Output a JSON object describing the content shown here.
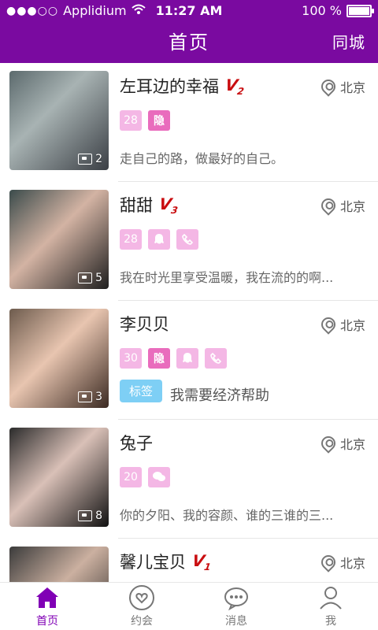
{
  "statusbar": {
    "carrier": "Applidium",
    "time": "11:27 AM",
    "battery": "100 %"
  },
  "header": {
    "title": "首页",
    "right_link": "同城"
  },
  "list": [
    {
      "name": "左耳边的幸福",
      "vip_level": "2",
      "location": "北京",
      "age": "28",
      "badges": [
        "隐"
      ],
      "desc": "走自己的路，做最好的自己。",
      "photo_count": "2"
    },
    {
      "name": "甜甜",
      "vip_level": "3",
      "location": "北京",
      "age": "28",
      "badges": [
        "qq-icon",
        "phone-icon"
      ],
      "desc": "我在时光里享受温暖，我在流的的啊...",
      "photo_count": "5"
    },
    {
      "name": "李贝贝",
      "vip_level": "",
      "location": "北京",
      "age": "30",
      "badges": [
        "隐",
        "qq-icon",
        "phone-icon"
      ],
      "tag": "标签",
      "desc": "我需要经济帮助",
      "photo_count": "3"
    },
    {
      "name": "兔子",
      "vip_level": "",
      "location": "北京",
      "age": "20",
      "badges": [
        "wechat-icon"
      ],
      "desc": "你的夕阳、我的容颜、谁的三谁的三...",
      "photo_count": "8"
    },
    {
      "name": "馨儿宝贝",
      "vip_level": "1",
      "location": "北京",
      "age": "",
      "badges": [],
      "desc": "",
      "photo_count": ""
    }
  ],
  "tabs": [
    {
      "label": "首页",
      "active": true
    },
    {
      "label": "约会",
      "active": false
    },
    {
      "label": "消息",
      "active": false
    },
    {
      "label": "我",
      "active": false
    }
  ],
  "colors": {
    "header_bg": "#7a0aa0",
    "tab_active": "#8000b5",
    "badge_pink": "#f4b7e5",
    "badge_hide": "#e96cbd",
    "tag_blue": "#7ecff5",
    "vip_red": "#c90d10"
  }
}
